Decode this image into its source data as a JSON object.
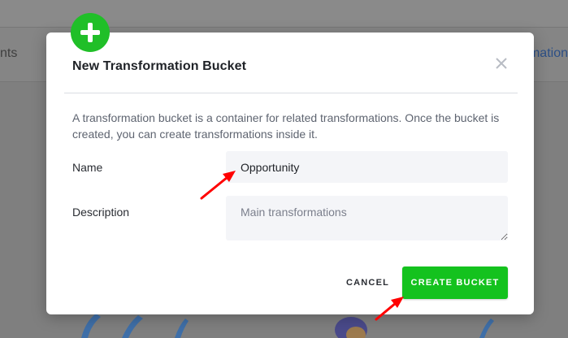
{
  "background": {
    "tab_left_fragment": "nts",
    "tab_right_fragment": "mation"
  },
  "dialog": {
    "title": "New Transformation Bucket",
    "description": "A transformation bucket is a container for related transformations. Once the bucket is created, you can create transformations inside it.",
    "name_label": "Name",
    "name_value": "Opportunity",
    "description_label": "Description",
    "description_placeholder": "Main transformations",
    "cancel_label": "CANCEL",
    "create_label": "CREATE BUCKET"
  },
  "icons": {
    "badge": "plus-icon",
    "close": "close-icon",
    "annotations": "red-arrow-icon"
  },
  "colors": {
    "primary_green": "#14c21e",
    "badge_green": "#20bf28",
    "annotation_red": "#ff0000",
    "input_bg": "#f4f5f8"
  }
}
